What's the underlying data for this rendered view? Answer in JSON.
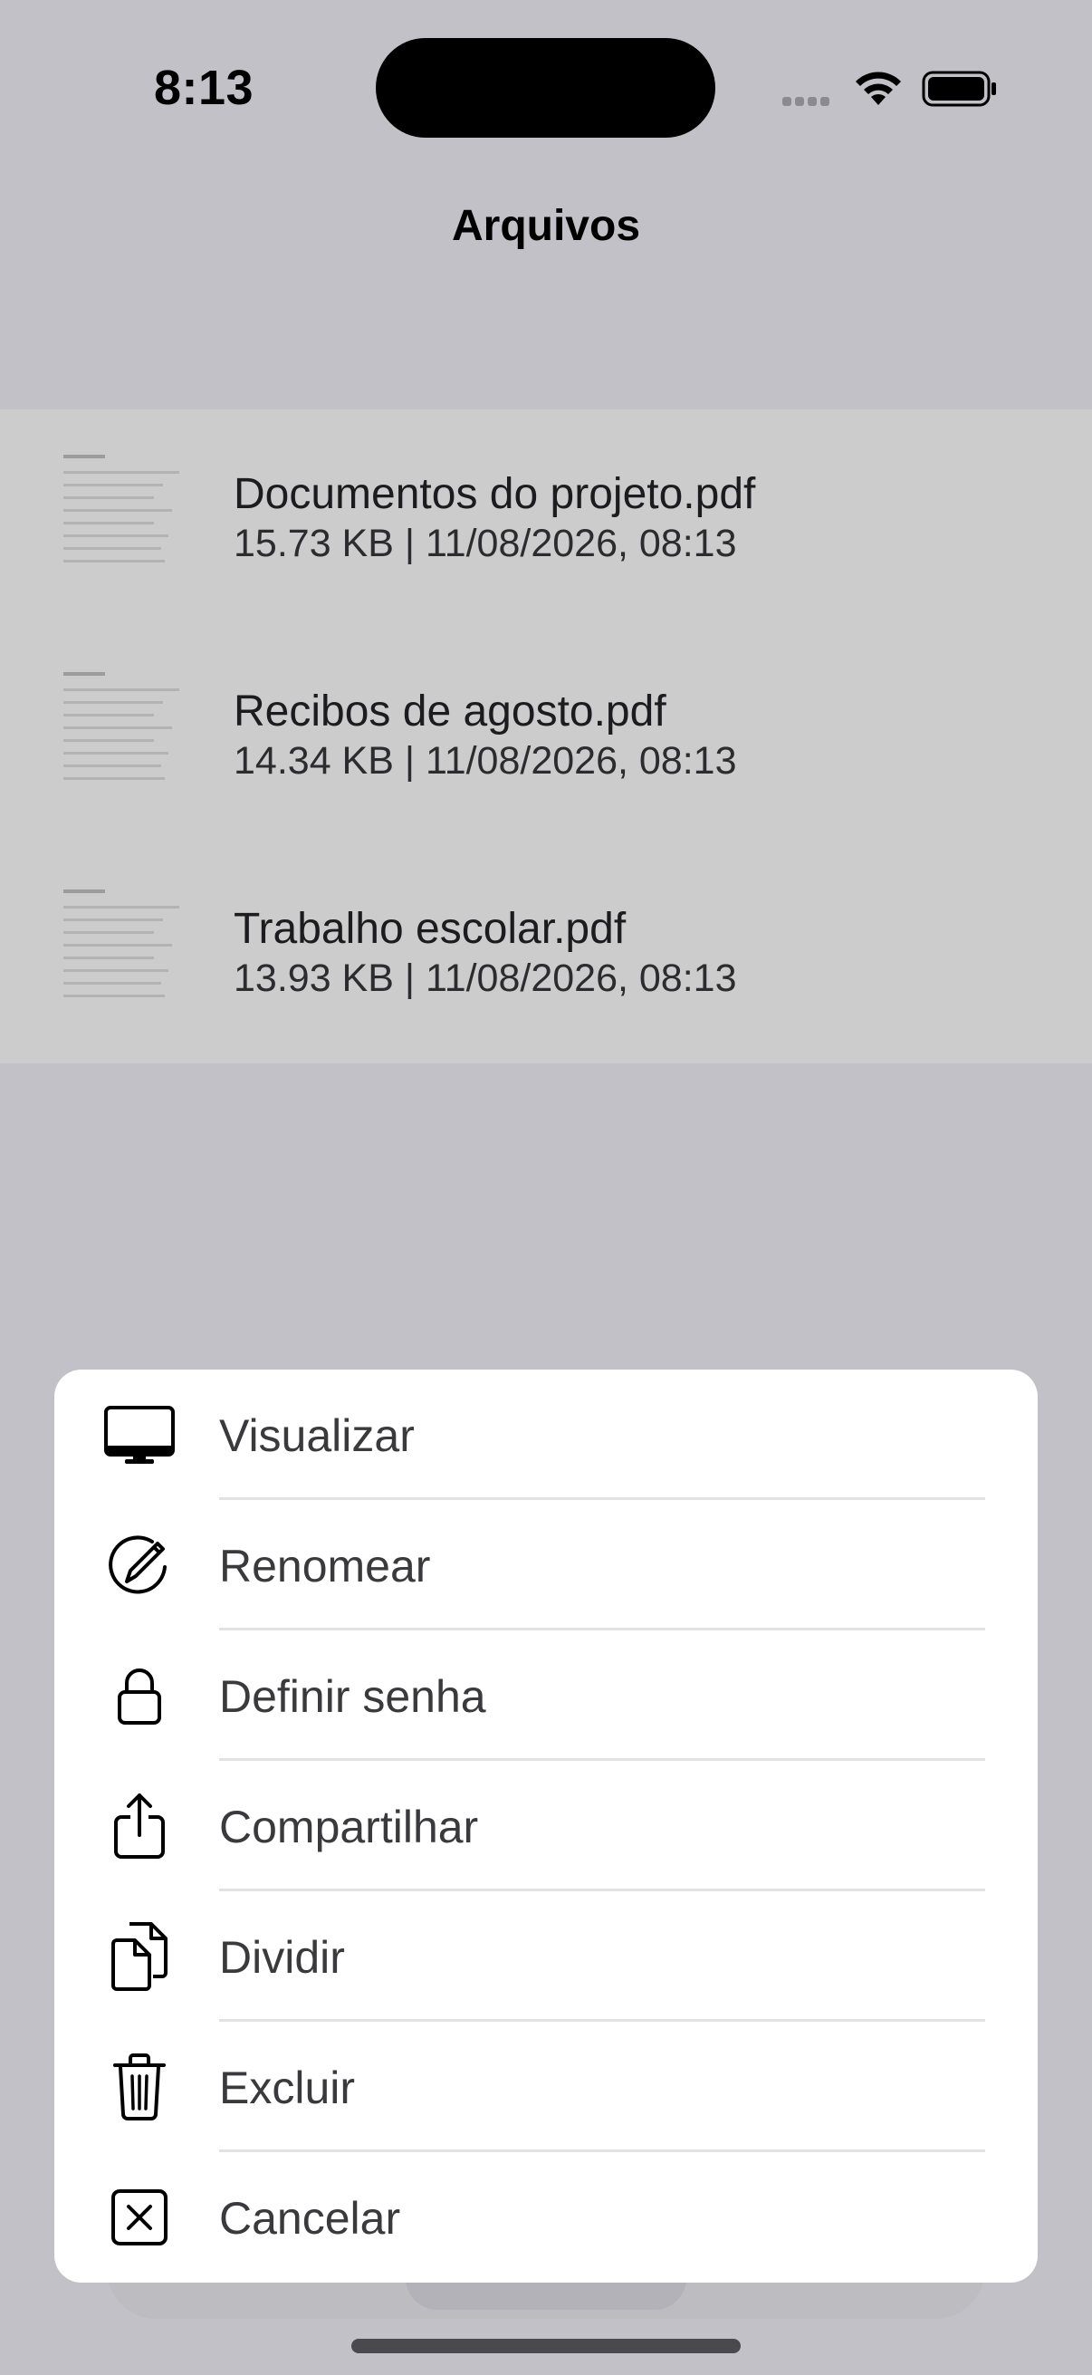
{
  "status_bar": {
    "time": "8:13"
  },
  "header": {
    "title": "Arquivos"
  },
  "files": [
    {
      "name": "Documentos do projeto.pdf",
      "meta": "15.73 KB | 11/08/2026, 08:13"
    },
    {
      "name": "Recibos de agosto.pdf",
      "meta": "14.34 KB | 11/08/2026, 08:13"
    },
    {
      "name": "Trabalho escolar.pdf",
      "meta": "13.93 KB | 11/08/2026, 08:13"
    }
  ],
  "action_sheet": {
    "items": [
      {
        "label": "Visualizar",
        "icon": "display-icon"
      },
      {
        "label": "Renomear",
        "icon": "rename-icon"
      },
      {
        "label": "Definir senha",
        "icon": "lock-icon"
      },
      {
        "label": "Compartilhar",
        "icon": "share-icon"
      },
      {
        "label": "Dividir",
        "icon": "split-documents-icon"
      },
      {
        "label": "Excluir",
        "icon": "trash-icon"
      },
      {
        "label": "Cancelar",
        "icon": "close-box-icon"
      }
    ]
  },
  "colors": {
    "dim_background": "#c2c1c7",
    "list_background": "#cccccc",
    "sheet_background": "#ffffff",
    "label_text": "#3a3a3c"
  }
}
